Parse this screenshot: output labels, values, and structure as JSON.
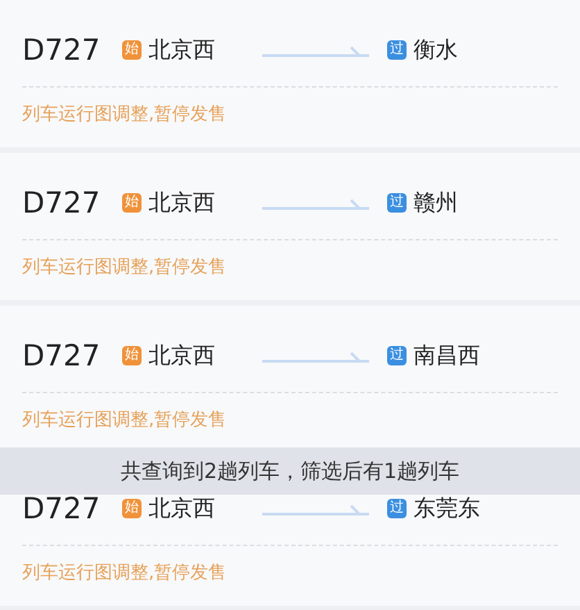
{
  "trains": [
    {
      "number": "D727",
      "from": {
        "badge": "始",
        "kind": "start",
        "station": "北京西"
      },
      "to": {
        "badge": "过",
        "kind": "pass",
        "station": "衡水"
      },
      "status": "列车运行图调整,暂停发售"
    },
    {
      "number": "D727",
      "from": {
        "badge": "始",
        "kind": "start",
        "station": "北京西"
      },
      "to": {
        "badge": "过",
        "kind": "pass",
        "station": "赣州"
      },
      "status": "列车运行图调整,暂停发售"
    },
    {
      "number": "D727",
      "from": {
        "badge": "始",
        "kind": "start",
        "station": "北京西"
      },
      "to": {
        "badge": "过",
        "kind": "pass",
        "station": "南昌西"
      },
      "status": "列车运行图调整,暂停发售"
    },
    {
      "number": "D727",
      "from": {
        "badge": "始",
        "kind": "start",
        "station": "北京西"
      },
      "to": {
        "badge": "过",
        "kind": "pass",
        "station": "东莞东"
      },
      "status": "列车运行图调整,暂停发售"
    }
  ],
  "toast": "共查询到2趟列车，筛选后有1趟列车"
}
